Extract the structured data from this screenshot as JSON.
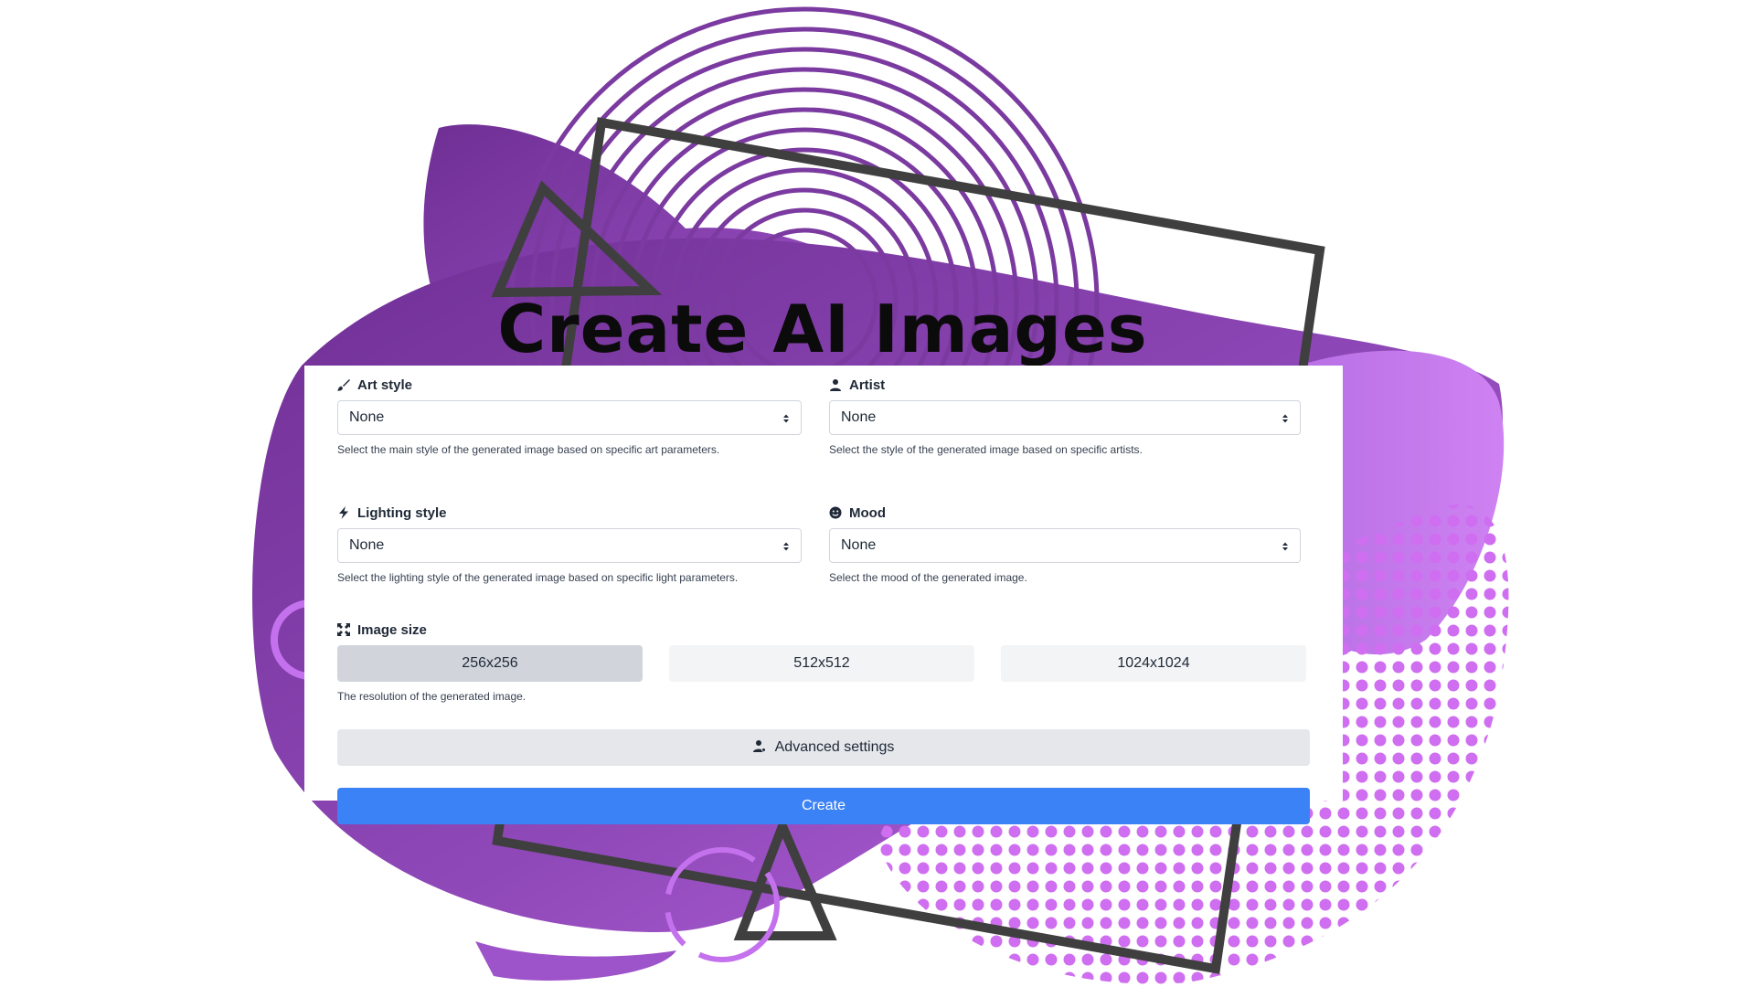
{
  "page": {
    "title": "Create AI Images"
  },
  "form": {
    "art_style": {
      "label": "Art style",
      "icon": "paintbrush-icon",
      "value": "None",
      "help": "Select the main style of the generated image based on specific art parameters."
    },
    "artist": {
      "label": "Artist",
      "icon": "user-icon",
      "value": "None",
      "help": "Select the style of the generated image based on specific artists."
    },
    "lighting_style": {
      "label": "Lighting style",
      "icon": "lightning-bolt-icon",
      "value": "None",
      "help": "Select the lighting style of the generated image based on specific light parameters."
    },
    "mood": {
      "label": "Mood",
      "icon": "smiley-icon",
      "value": "None",
      "help": "Select the mood of the generated image."
    },
    "image_size": {
      "label": "Image size",
      "icon": "expand-icon",
      "options": [
        "256x256",
        "512x512",
        "1024x1024"
      ],
      "selected": "256x256",
      "help": "The resolution of the generated image."
    },
    "advanced_label": "Advanced settings",
    "create_label": "Create"
  },
  "colors": {
    "purple_dark": "#7b3aa0",
    "purple_light": "#c471ed",
    "frame_gray": "#3f3f3f",
    "primary_blue": "#3b82f6"
  }
}
